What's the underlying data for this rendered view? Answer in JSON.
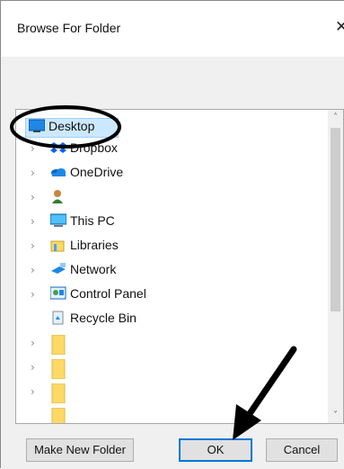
{
  "dialog": {
    "title": "Browse For Folder",
    "close_glyph": "✕"
  },
  "tree": {
    "items": [
      {
        "label": "Desktop",
        "icon": "desktop-icon",
        "has_chevron": false,
        "selected": true
      },
      {
        "label": "Dropbox",
        "icon": "dropbox-icon",
        "has_chevron": true
      },
      {
        "label": "OneDrive",
        "icon": "onedrive-icon",
        "has_chevron": true
      },
      {
        "label": "",
        "icon": "user-icon",
        "has_chevron": true
      },
      {
        "label": "This PC",
        "icon": "computer-icon",
        "has_chevron": true
      },
      {
        "label": "Libraries",
        "icon": "libraries-icon",
        "has_chevron": true
      },
      {
        "label": "Network",
        "icon": "network-icon",
        "has_chevron": true
      },
      {
        "label": "Control Panel",
        "icon": "control-panel-icon",
        "has_chevron": true
      },
      {
        "label": "Recycle Bin",
        "icon": "recycle-bin-icon",
        "has_chevron": false
      },
      {
        "label": "",
        "icon": "folder-icon",
        "has_chevron": true
      },
      {
        "label": "",
        "icon": "folder-icon",
        "has_chevron": true
      },
      {
        "label": "",
        "icon": "folder-icon",
        "has_chevron": true
      },
      {
        "label": "",
        "icon": "folder-icon",
        "has_chevron": false
      }
    ],
    "chevron_glyph": "›",
    "scroll_up_glyph": "˄",
    "scroll_down_glyph": "˅"
  },
  "buttons": {
    "make_new_folder": "Make New Folder",
    "ok": "OK",
    "cancel": "Cancel"
  },
  "colors": {
    "selection": "#cce8ff",
    "accent": "#0078d7",
    "folder": "#ffd966"
  }
}
